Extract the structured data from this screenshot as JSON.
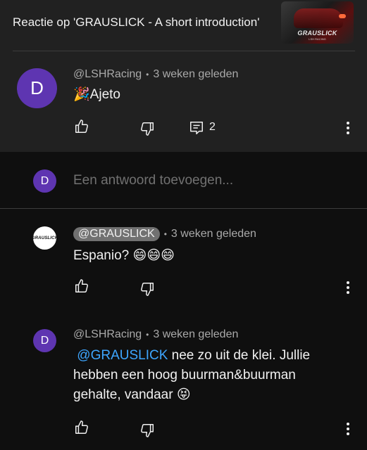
{
  "header": {
    "title": "Reactie op 'GRAUSLICK - A short introduction'",
    "thumbnail": {
      "brand": "GRAUSLICK",
      "subtitle": "LSH RACING"
    }
  },
  "main_comment": {
    "avatar_letter": "D",
    "author": "@LSHRacing",
    "time": "3 weken geleden",
    "emoji": "🎉",
    "text": "Ajeto",
    "reply_count": "2"
  },
  "reply_box": {
    "avatar_letter": "D",
    "placeholder": "Een antwoord toevoegen..."
  },
  "replies": [
    {
      "avatar_logo": "GRAUSLICK",
      "author": "@GRAUSLICK",
      "time": "3 weken geleden",
      "text": "Espanio? 😄😄😄"
    },
    {
      "avatar_letter": "D",
      "author": "@LSHRacing",
      "time": "3 weken geleden",
      "mention": "@GRAUSLICK",
      "text_line1": " nee zo uit de klei. Jullie",
      "text_line2": "hebben een hoog buurman&buurman",
      "text_line3": "gehalte, vandaar 😝"
    }
  ],
  "colors": {
    "background": "#0f0f0f",
    "header_background": "#212121",
    "avatar": "#5e35b1",
    "mention": "#3ea6ff"
  },
  "icons": [
    "like-icon",
    "dislike-icon",
    "reply-icon",
    "more-vert-icon"
  ]
}
